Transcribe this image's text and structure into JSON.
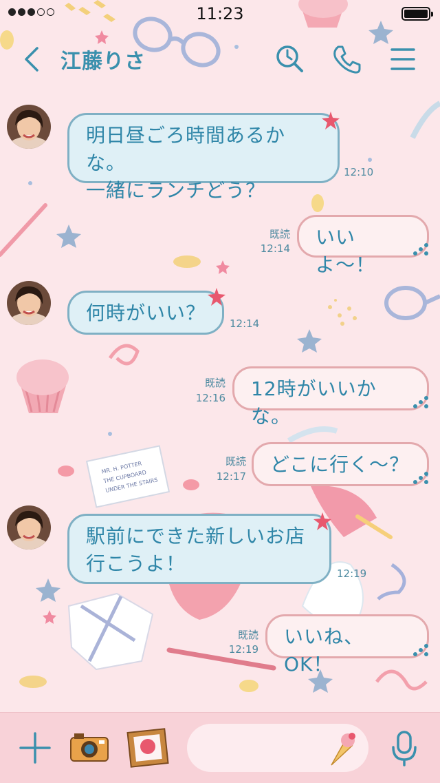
{
  "status_bar": {
    "time": "11:23",
    "signal_bars": 3,
    "signal_total": 5
  },
  "header": {
    "contact_name": "江藤りさ"
  },
  "messages": [
    {
      "direction": "in",
      "lines": [
        "明日昼ごろ時間あるかな。",
        "一緒にランチどう？"
      ],
      "time": "12:10"
    },
    {
      "direction": "out",
      "text": "いいよ〜！",
      "read": "既読",
      "time": "12:14"
    },
    {
      "direction": "in",
      "lines": [
        "何時がいい？"
      ],
      "time": "12:14"
    },
    {
      "direction": "out",
      "text": "12時がいいかな。",
      "read": "既読",
      "time": "12:16"
    },
    {
      "direction": "out",
      "text": "どこに行く〜？",
      "read": "既読",
      "time": "12:17"
    },
    {
      "direction": "in",
      "lines": [
        "駅前にできた新しいお店",
        "行こうよ！"
      ],
      "time": "12:19"
    },
    {
      "direction": "out",
      "text": "いいね、OK！",
      "read": "既読",
      "time": "12:19"
    }
  ],
  "decor": {
    "envelope_text": [
      "MR. H. POTTER",
      "THE CUPBOARD",
      "UNDER THE STAIRS"
    ]
  },
  "colors": {
    "accent": "#3a90ad",
    "background": "#fce7ea",
    "bubble_in": "#dff0f6",
    "bubble_out": "#fdf0f1",
    "input_bar": "#f8d2d8"
  }
}
